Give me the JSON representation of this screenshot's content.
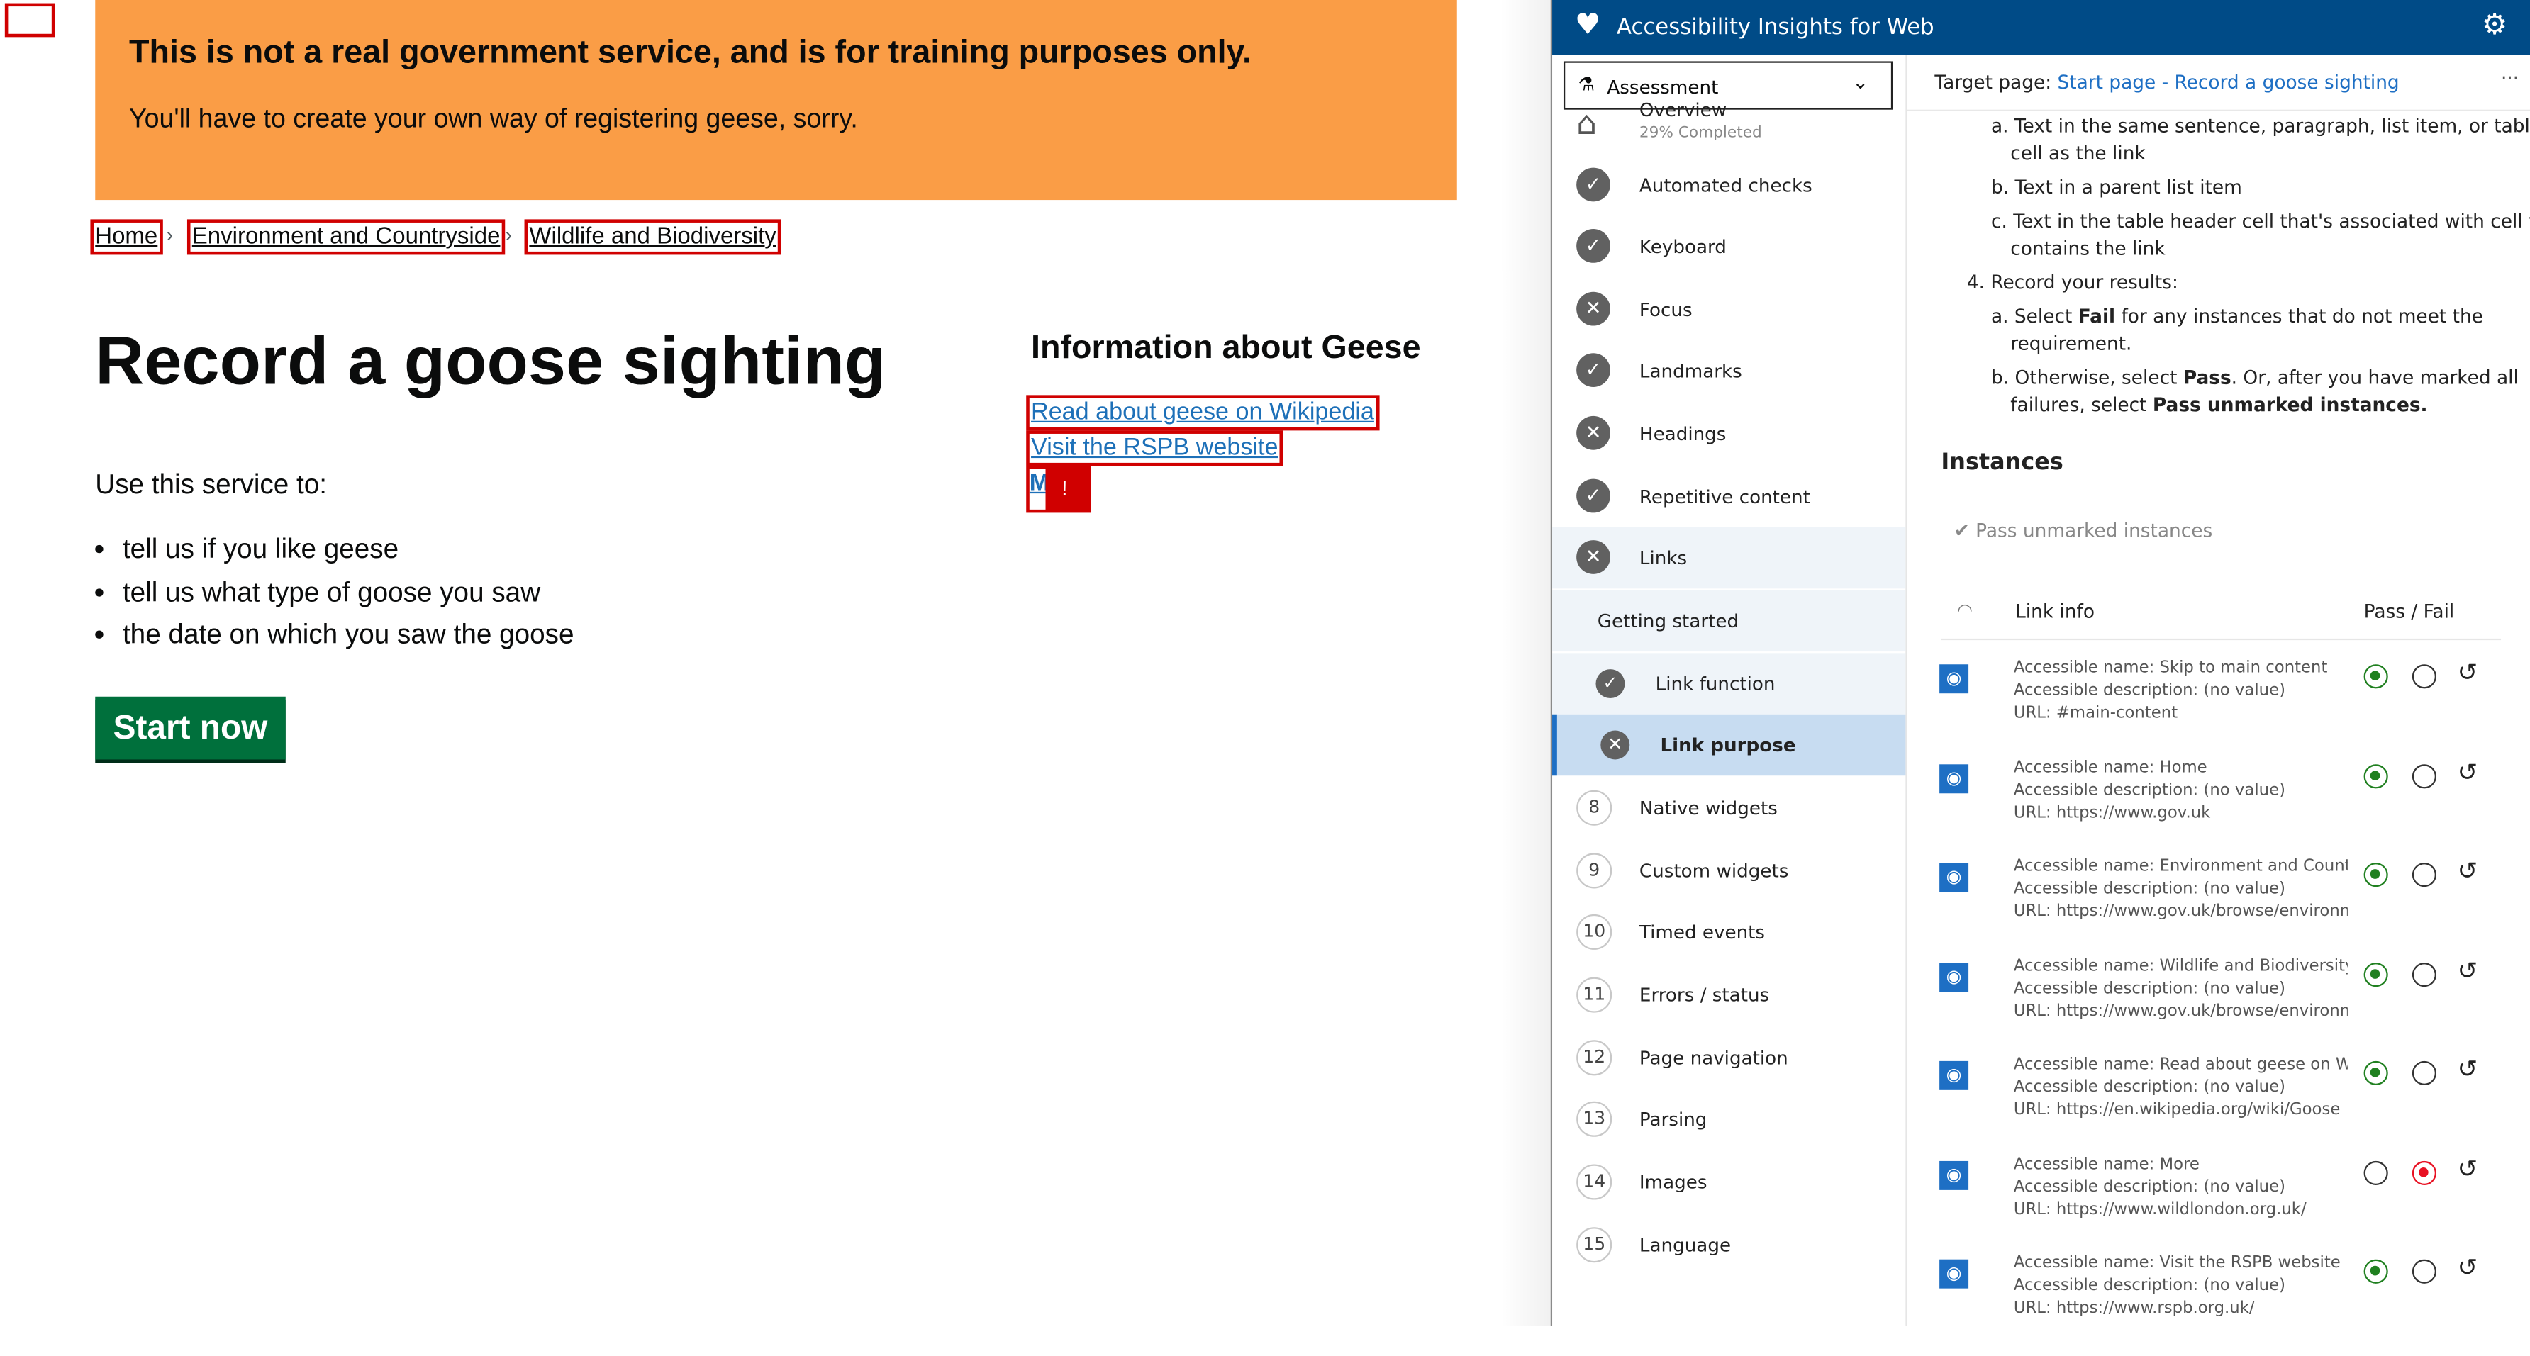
{
  "page": {
    "banner": {
      "title": "This is not a real government service, and is for training purposes only.",
      "text": "You'll have to create your own way of registering geese, sorry."
    },
    "breadcrumbs": [
      "Home",
      "Environment and Countryside",
      "Wildlife and Biodiversity"
    ],
    "heading": "Record a goose sighting",
    "intro": "Use this service to:",
    "bullets": [
      "tell us if you like geese",
      "tell us what type of goose you saw",
      "the date on which you saw the goose"
    ],
    "start_button": "Start now",
    "related": {
      "heading": "Information about Geese",
      "links": [
        "Read about geese on Wikipedia",
        "Visit the RSPB website",
        "M"
      ],
      "failure_marker": "!"
    }
  },
  "panel": {
    "title": "Accessibility Insights for Web",
    "mode_select": "Assessment",
    "target_label": "Target page:",
    "target_link": "Start page - Record a goose sighting",
    "more": "···",
    "nav": [
      {
        "label": "Overview",
        "sub": "29% Completed",
        "icon": "home-icon"
      },
      {
        "label": "Automated checks",
        "status": "pass"
      },
      {
        "label": "Keyboard",
        "status": "pass"
      },
      {
        "label": "Focus",
        "status": "fail"
      },
      {
        "label": "Landmarks",
        "status": "pass"
      },
      {
        "label": "Headings",
        "status": "fail"
      },
      {
        "label": "Repetitive content",
        "status": "pass"
      },
      {
        "label": "Links",
        "status": "fail"
      },
      {
        "label": "Getting started"
      },
      {
        "label": "Link function",
        "status": "pass"
      },
      {
        "label": "Link purpose",
        "status": "fail",
        "selected": true
      },
      {
        "label": "Native widgets",
        "num": "8"
      },
      {
        "label": "Custom widgets",
        "num": "9"
      },
      {
        "label": "Timed events",
        "num": "10"
      },
      {
        "label": "Errors / status",
        "num": "11"
      },
      {
        "label": "Page navigation",
        "num": "12"
      },
      {
        "label": "Parsing",
        "num": "13"
      },
      {
        "label": "Images",
        "num": "14"
      },
      {
        "label": "Language",
        "num": "15"
      }
    ],
    "instructions": {
      "a1": "a. Text in the same sentence, paragraph, list item, or table",
      "a1b": "cell as the link",
      "b1": "b. Text in a parent list item",
      "c1": "c. Text in the table header cell that's associated with cell that",
      "c1b": "contains the link",
      "step4": "4. Record your results:",
      "a2_pre": "a. Select ",
      "a2_bold": "Fail",
      "a2_post": " for any instances that do not meet the",
      "a2b": "requirement.",
      "b2_pre": "b. Otherwise, select ",
      "b2_bold": "Pass",
      "b2_post": ". Or, after you have marked all",
      "b2b_pre": "failures, select ",
      "b2b_bold": "Pass unmarked instances."
    },
    "instances_heading": "Instances",
    "pass_unmarked": "Pass unmarked instances",
    "col_info": "Link info",
    "col_passfail": "Pass / Fail",
    "colors": {
      "pass": "#208020",
      "fail": "#e81123",
      "header": "#004b87",
      "selected": "#c7dcf1"
    },
    "instances": [
      {
        "name": "Accessible name: Skip to main content",
        "desc": "Accessible description: (no value)",
        "url": "URL: #main-content",
        "result": "pass"
      },
      {
        "name": "Accessible name: Home",
        "desc": "Accessible description: (no value)",
        "url": "URL: https://www.gov.uk",
        "result": "pass"
      },
      {
        "name": "Accessible name: Environment and Countrys",
        "desc": "Accessible description: (no value)",
        "url": "URL: https://www.gov.uk/browse/environme",
        "result": "pass"
      },
      {
        "name": "Accessible name: Wildlife and Biodiversity",
        "desc": "Accessible description: (no value)",
        "url": "URL: https://www.gov.uk/browse/environme",
        "result": "pass"
      },
      {
        "name": "Accessible name: Read about geese on Wiki",
        "desc": "Accessible description: (no value)",
        "url": "URL: https://en.wikipedia.org/wiki/Goose",
        "result": "pass"
      },
      {
        "name": "Accessible name: More",
        "desc": "Accessible description: (no value)",
        "url": "URL: https://www.wildlondon.org.uk/",
        "result": "fail"
      },
      {
        "name": "Accessible name: Visit the RSPB website",
        "desc": "Accessible description: (no value)",
        "url": "URL: https://www.rspb.org.uk/",
        "result": "pass"
      }
    ]
  }
}
